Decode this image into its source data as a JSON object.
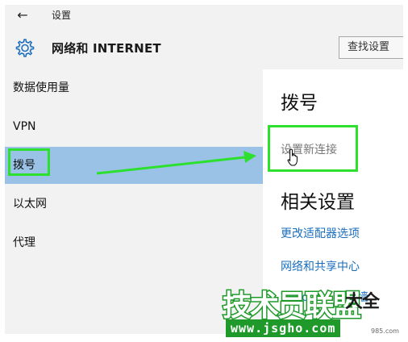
{
  "window": {
    "title": "设置"
  },
  "header": {
    "title": "网络和 INTERNET",
    "search_label": "查找设置"
  },
  "nav": {
    "items": [
      {
        "label": "数据使用量",
        "selected": false
      },
      {
        "label": "VPN",
        "selected": false
      },
      {
        "label": "拨号",
        "selected": true
      },
      {
        "label": "以太网",
        "selected": false
      },
      {
        "label": "代理",
        "selected": false
      }
    ]
  },
  "content": {
    "title": "拨号",
    "new_connection": "设置新连接",
    "related_title": "相关设置",
    "links": [
      "更改适配器选项",
      "网络和共享中心",
      "Windows 防火墙"
    ]
  },
  "watermark": {
    "main": "技术员联盟",
    "side": "大全",
    "url": "www.jsgho.com",
    "url_side": "985.com"
  },
  "colors": {
    "selected_bg": "#99c2e6",
    "highlight": "#2ee02e",
    "link": "#1a6fbf",
    "watermark_green": "#1f9a2a"
  },
  "icons": {
    "back": "back-arrow-icon",
    "settings": "gear-icon",
    "cursor": "hand-pointer-icon"
  }
}
